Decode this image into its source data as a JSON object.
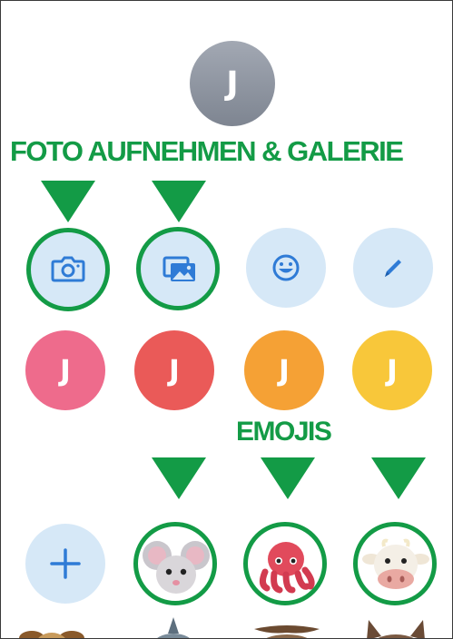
{
  "profile": {
    "initial": "J"
  },
  "captions": {
    "photo_gallery": "FOTO AUFNEHMEN & GALERIE",
    "emojis": "EMOJIS"
  },
  "actions": [
    {
      "name": "camera-icon"
    },
    {
      "name": "gallery-icon"
    },
    {
      "name": "emoji-icon"
    },
    {
      "name": "pencil-icon"
    }
  ],
  "initials_row": [
    {
      "letter": "J",
      "color": "#ee6b8c"
    },
    {
      "letter": "J",
      "color": "#ea5a58"
    },
    {
      "letter": "J",
      "color": "#f5a135"
    },
    {
      "letter": "J",
      "color": "#f8c73a"
    }
  ],
  "memoji_row": [
    {
      "name": "add-icon"
    },
    {
      "name": "mouse-memoji"
    },
    {
      "name": "octopus-memoji"
    },
    {
      "name": "cow-memoji"
    }
  ],
  "colors": {
    "accent_green": "#139b46",
    "icon_blue": "#2f7bd6",
    "light_blue": "#d6e8f7"
  }
}
